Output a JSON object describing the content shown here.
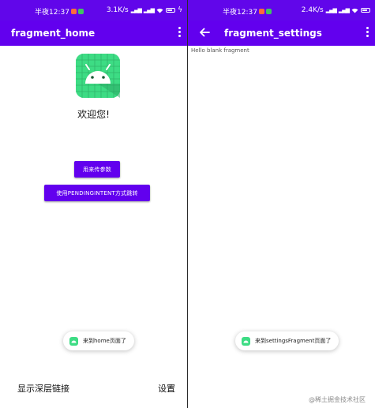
{
  "left_screen": {
    "status": {
      "time": "半夜12:37",
      "network_speed": "3.1K/s"
    },
    "app_bar": {
      "title": "fragment_home"
    },
    "welcome_text": "欢迎您!",
    "buttons": {
      "pass_params": "用来传参数",
      "pending_intent": "使用PENDINGINTENT方式跳转"
    },
    "toast": "来到home页面了",
    "bottom_nav": {
      "deep_link": "显示深层链接",
      "settings": "设置"
    }
  },
  "right_screen": {
    "status": {
      "time": "半夜12:37",
      "network_speed": "2.4K/s"
    },
    "app_bar": {
      "title": "fragment_settings"
    },
    "blank_text": "Hello blank fragment",
    "toast": "来到settingsFragment页面了"
  },
  "watermark": "@稀土掘金技术社区",
  "colors": {
    "primary": "#6200ee",
    "status_bar": "#6106ea",
    "android_green": "#3ddc84"
  },
  "icons": [
    "android-app-icon",
    "overflow-menu-icon",
    "back-arrow-icon",
    "wifi-icon",
    "battery-icon",
    "signal-icon"
  ]
}
